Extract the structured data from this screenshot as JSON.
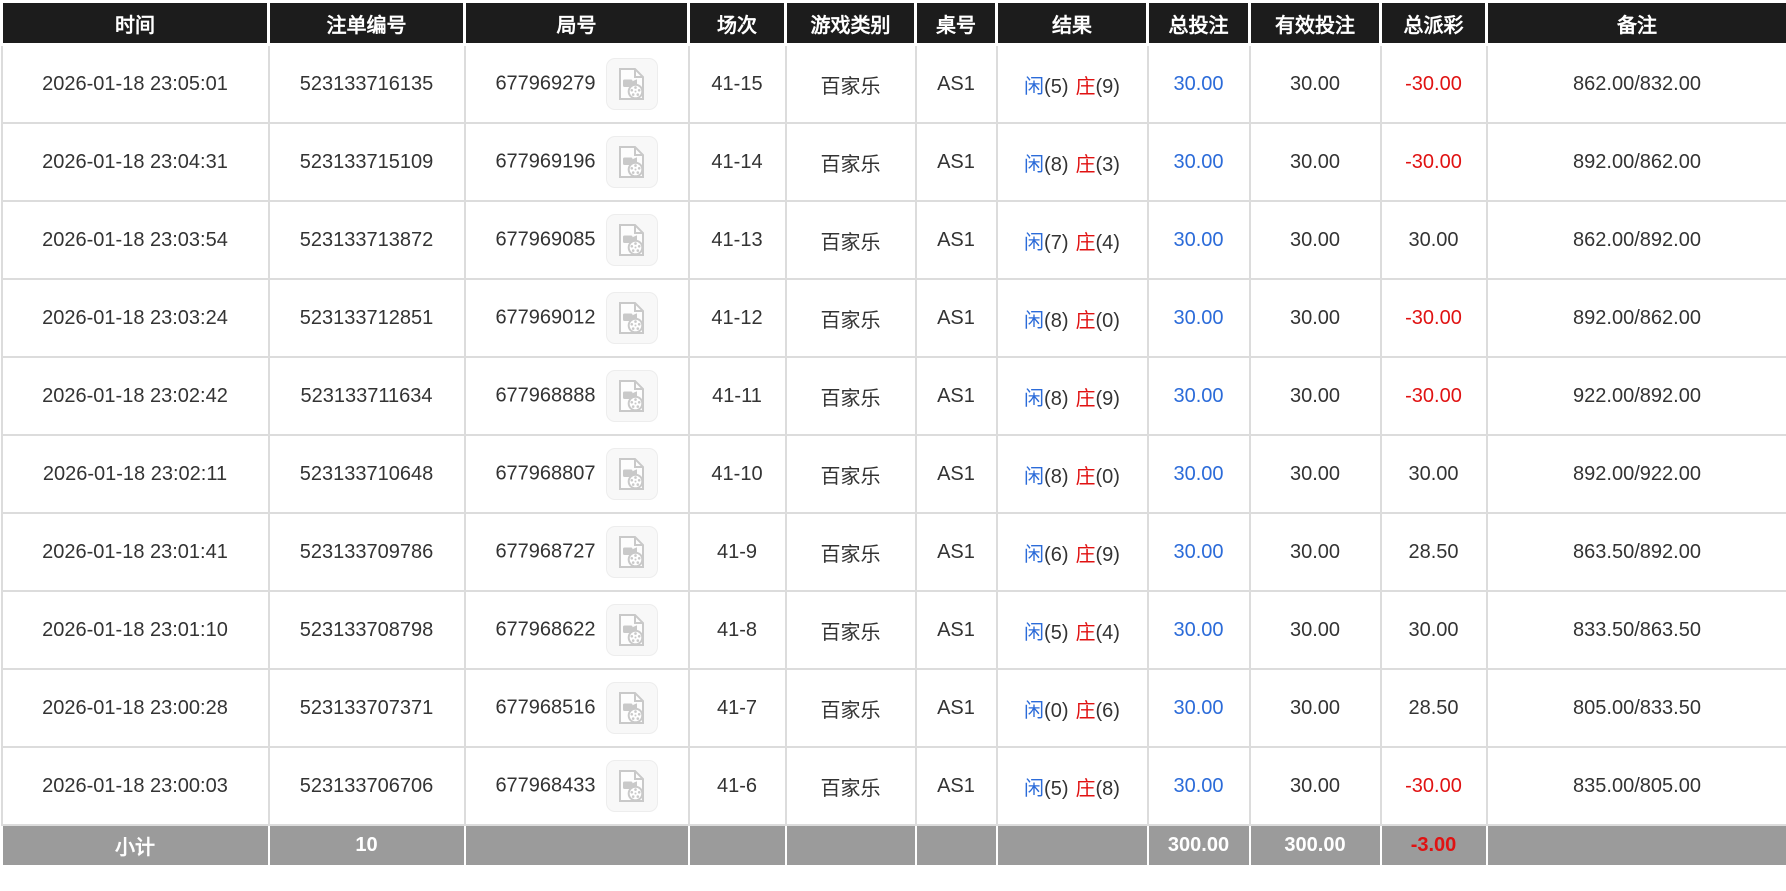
{
  "colors": {
    "header_bg": "#1c1c1c",
    "header_text": "#ffffff",
    "body_text": "#333333",
    "summary_bg": "#9b9b9b",
    "player_blue": "#2b6bd9",
    "banker_red": "#e01212",
    "total_bet_blue": "#2b6bd9",
    "negative_red": "#e01212"
  },
  "icons": {
    "video_replay": "document-with-film-reel-and-camera"
  },
  "table": {
    "columns": [
      "时间",
      "注单编号",
      "局号",
      "场次",
      "游戏类别",
      "桌号",
      "结果",
      "总投注",
      "有效投注",
      "总派彩",
      "备注"
    ],
    "rows": [
      {
        "time": "2026-01-18 23:05:01",
        "bet_no": "523133716135",
        "round_no": "677969279",
        "session": "41-15",
        "game_type": "百家乐",
        "table_no": "AS1",
        "result_player": "闲",
        "result_player_score": "(5)",
        "result_banker": "庄",
        "result_banker_score": "(9)",
        "total_bet": "30.00",
        "valid_bet": "30.00",
        "payout": "-30.00",
        "remark": "862.00/832.00"
      },
      {
        "time": "2026-01-18 23:04:31",
        "bet_no": "523133715109",
        "round_no": "677969196",
        "session": "41-14",
        "game_type": "百家乐",
        "table_no": "AS1",
        "result_player": "闲",
        "result_player_score": "(8)",
        "result_banker": "庄",
        "result_banker_score": "(3)",
        "total_bet": "30.00",
        "valid_bet": "30.00",
        "payout": "-30.00",
        "remark": "892.00/862.00"
      },
      {
        "time": "2026-01-18 23:03:54",
        "bet_no": "523133713872",
        "round_no": "677969085",
        "session": "41-13",
        "game_type": "百家乐",
        "table_no": "AS1",
        "result_player": "闲",
        "result_player_score": "(7)",
        "result_banker": "庄",
        "result_banker_score": "(4)",
        "total_bet": "30.00",
        "valid_bet": "30.00",
        "payout": "30.00",
        "remark": "862.00/892.00"
      },
      {
        "time": "2026-01-18 23:03:24",
        "bet_no": "523133712851",
        "round_no": "677969012",
        "session": "41-12",
        "game_type": "百家乐",
        "table_no": "AS1",
        "result_player": "闲",
        "result_player_score": "(8)",
        "result_banker": "庄",
        "result_banker_score": "(0)",
        "total_bet": "30.00",
        "valid_bet": "30.00",
        "payout": "-30.00",
        "remark": "892.00/862.00"
      },
      {
        "time": "2026-01-18 23:02:42",
        "bet_no": "523133711634",
        "round_no": "677968888",
        "session": "41-11",
        "game_type": "百家乐",
        "table_no": "AS1",
        "result_player": "闲",
        "result_player_score": "(8)",
        "result_banker": "庄",
        "result_banker_score": "(9)",
        "total_bet": "30.00",
        "valid_bet": "30.00",
        "payout": "-30.00",
        "remark": "922.00/892.00"
      },
      {
        "time": "2026-01-18 23:02:11",
        "bet_no": "523133710648",
        "round_no": "677968807",
        "session": "41-10",
        "game_type": "百家乐",
        "table_no": "AS1",
        "result_player": "闲",
        "result_player_score": "(8)",
        "result_banker": "庄",
        "result_banker_score": "(0)",
        "total_bet": "30.00",
        "valid_bet": "30.00",
        "payout": "30.00",
        "remark": "892.00/922.00"
      },
      {
        "time": "2026-01-18 23:01:41",
        "bet_no": "523133709786",
        "round_no": "677968727",
        "session": "41-9",
        "game_type": "百家乐",
        "table_no": "AS1",
        "result_player": "闲",
        "result_player_score": "(6)",
        "result_banker": "庄",
        "result_banker_score": "(9)",
        "total_bet": "30.00",
        "valid_bet": "30.00",
        "payout": "28.50",
        "remark": "863.50/892.00"
      },
      {
        "time": "2026-01-18 23:01:10",
        "bet_no": "523133708798",
        "round_no": "677968622",
        "session": "41-8",
        "game_type": "百家乐",
        "table_no": "AS1",
        "result_player": "闲",
        "result_player_score": "(5)",
        "result_banker": "庄",
        "result_banker_score": "(4)",
        "total_bet": "30.00",
        "valid_bet": "30.00",
        "payout": "30.00",
        "remark": "833.50/863.50"
      },
      {
        "time": "2026-01-18 23:00:28",
        "bet_no": "523133707371",
        "round_no": "677968516",
        "session": "41-7",
        "game_type": "百家乐",
        "table_no": "AS1",
        "result_player": "闲",
        "result_player_score": "(0)",
        "result_banker": "庄",
        "result_banker_score": "(6)",
        "total_bet": "30.00",
        "valid_bet": "30.00",
        "payout": "28.50",
        "remark": "805.00/833.50"
      },
      {
        "time": "2026-01-18 23:00:03",
        "bet_no": "523133706706",
        "round_no": "677968433",
        "session": "41-6",
        "game_type": "百家乐",
        "table_no": "AS1",
        "result_player": "闲",
        "result_player_score": "(5)",
        "result_banker": "庄",
        "result_banker_score": "(8)",
        "total_bet": "30.00",
        "valid_bet": "30.00",
        "payout": "-30.00",
        "remark": "835.00/805.00"
      }
    ],
    "summary": {
      "label": "小计",
      "bet_count": "10",
      "total_bet": "300.00",
      "valid_bet": "300.00",
      "payout": "-3.00"
    }
  }
}
